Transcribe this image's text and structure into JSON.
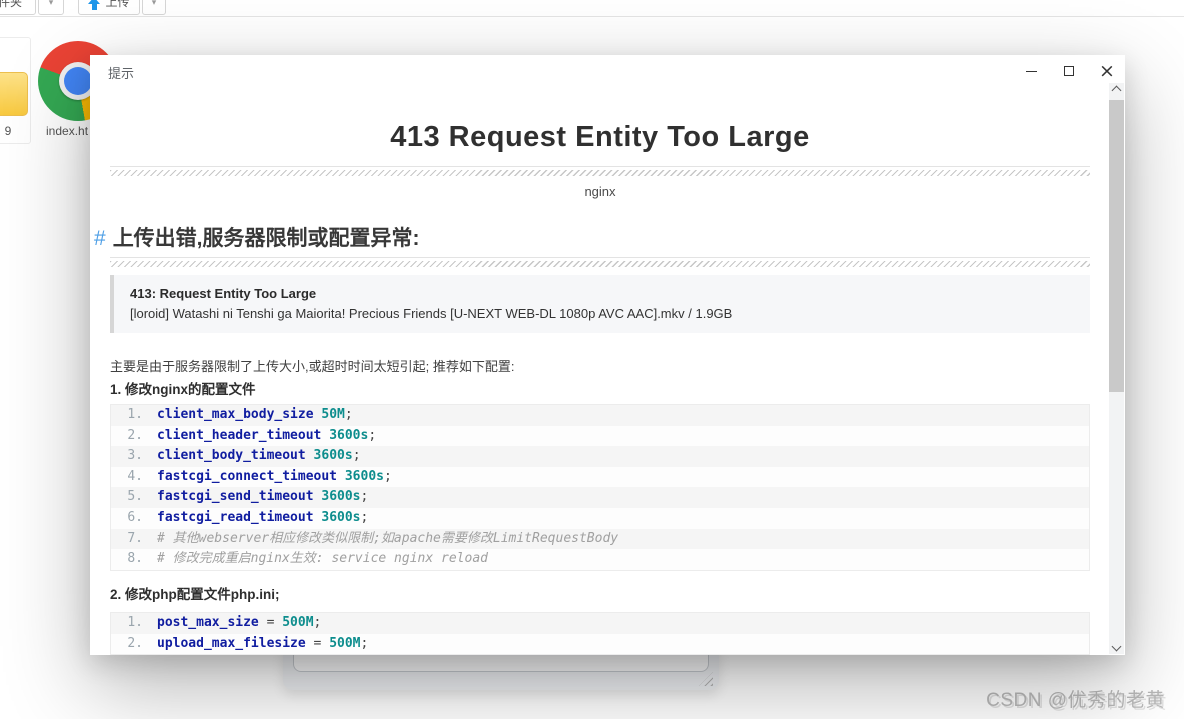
{
  "page": {
    "toolbar": {
      "folder_button_label": "件夹",
      "upload_button_label": "上传",
      "dropdown_caret": "▾"
    },
    "files": {
      "folder_tile_label": "9",
      "chrome_tile_label": "index.ht"
    },
    "watermark": "CSDN @优秀的老黄"
  },
  "icons": {
    "upload_arrow": "up-arrow",
    "minimize": "–",
    "maximize": "□",
    "close": "×",
    "scroll_up": "chevron-up",
    "scroll_down": "chevron-down"
  },
  "dialog": {
    "title": "提示",
    "error_page": {
      "h1": "413 Request Entity Too Large",
      "server": "nginx"
    },
    "article": {
      "heading_hash": "#",
      "heading_text": "上传出错,服务器限制或配置异常:",
      "quote_title": "413: Request Entity Too Large",
      "quote_body": "[loroid] Watashi ni Tenshi ga Maiorita! Precious Friends [U-NEXT WEB-DL 1080p AVC AAC].mkv / 1.9GB",
      "intro": "主要是由于服务器限制了上传大小,或超时时间太短引起; 推荐如下配置:",
      "step1_title": "1. 修改nginx的配置文件",
      "step2_title": "2. 修改php配置文件php.ini;"
    },
    "code_block_1": {
      "lines": [
        {
          "n": "1.",
          "parts": [
            [
              "d",
              "client_max_body_size"
            ],
            [
              "p",
              " "
            ],
            [
              "v",
              "50M"
            ],
            [
              "p",
              ";"
            ]
          ]
        },
        {
          "n": "2.",
          "parts": [
            [
              "d",
              "client_header_timeout"
            ],
            [
              "p",
              " "
            ],
            [
              "v",
              "3600s"
            ],
            [
              "p",
              ";"
            ]
          ]
        },
        {
          "n": "3.",
          "parts": [
            [
              "d",
              "client_body_timeout"
            ],
            [
              "p",
              " "
            ],
            [
              "v",
              "3600s"
            ],
            [
              "p",
              ";"
            ]
          ]
        },
        {
          "n": "4.",
          "parts": [
            [
              "d",
              "fastcgi_connect_timeout"
            ],
            [
              "p",
              " "
            ],
            [
              "v",
              "3600s"
            ],
            [
              "p",
              ";"
            ]
          ]
        },
        {
          "n": "5.",
          "parts": [
            [
              "d",
              "fastcgi_send_timeout"
            ],
            [
              "p",
              " "
            ],
            [
              "v",
              "3600s"
            ],
            [
              "p",
              ";"
            ]
          ]
        },
        {
          "n": "6.",
          "parts": [
            [
              "d",
              "fastcgi_read_timeout"
            ],
            [
              "p",
              " "
            ],
            [
              "v",
              "3600s"
            ],
            [
              "p",
              ";"
            ]
          ]
        },
        {
          "n": "7.",
          "parts": [
            [
              "c",
              "# 其他webserver相应修改类似限制;如apache需要修改LimitRequestBody"
            ]
          ]
        },
        {
          "n": "8.",
          "parts": [
            [
              "c",
              "# 修改完成重启nginx生效: service nginx reload"
            ]
          ]
        }
      ]
    },
    "code_block_2": {
      "lines": [
        {
          "n": "1.",
          "parts": [
            [
              "d",
              "post_max_size"
            ],
            [
              "p",
              " = "
            ],
            [
              "v",
              "500M"
            ],
            [
              "p",
              ";"
            ]
          ]
        },
        {
          "n": "2.",
          "parts": [
            [
              "d",
              "upload_max_filesize"
            ],
            [
              "p",
              " = "
            ],
            [
              "v",
              "500M"
            ],
            [
              "p",
              ";"
            ]
          ]
        }
      ]
    }
  },
  "colors": {
    "accent_blue": "#4e9fe6",
    "code_directive": "#101da0",
    "code_value": "#0d8d8d",
    "upload_arrow": "#1e96ea"
  }
}
